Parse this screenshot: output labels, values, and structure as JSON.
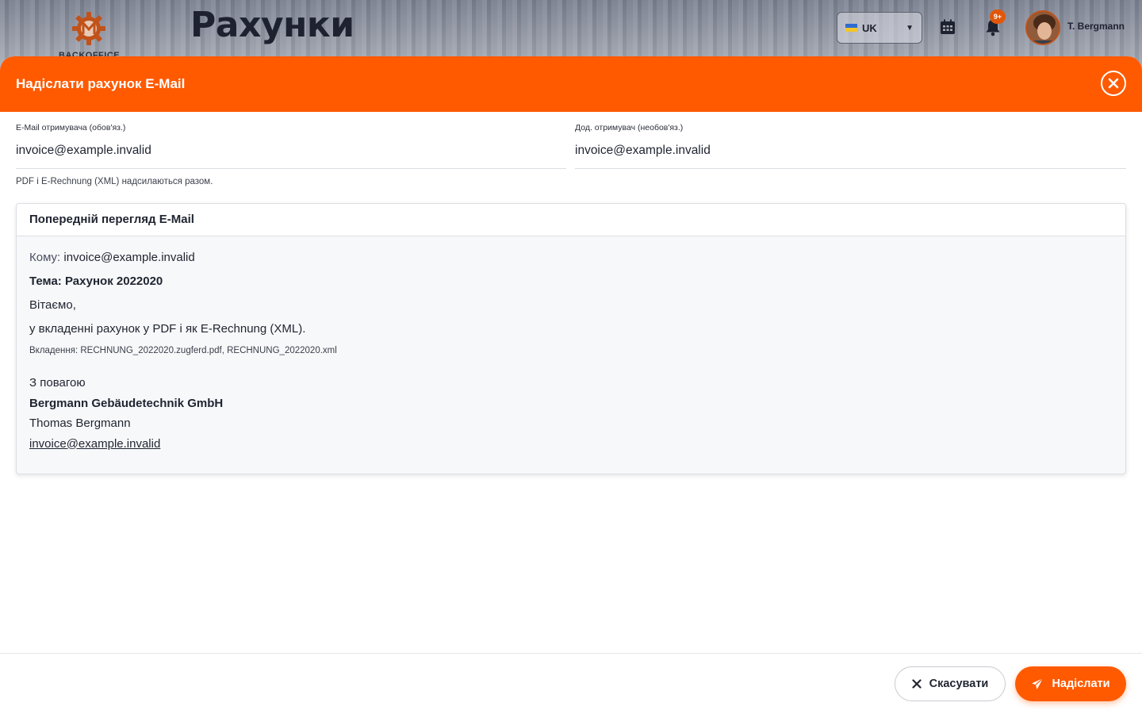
{
  "app": {
    "logo_text": "BACKOFFICE",
    "page_title": "Рахунки",
    "language": "UK",
    "notification_badge": "9+",
    "user_name": "T. Bergmann",
    "icons": [
      "logo-icon",
      "calendar-icon",
      "bell-icon",
      "avatar"
    ]
  },
  "colors": {
    "accent": "#ff5a00",
    "text": "#1f2430"
  },
  "modal": {
    "title": "Надіслати рахунок E-Mail",
    "recipient": {
      "label": "E-Mail отримувача (обов'яз.)",
      "value": "invoice@example.invalid"
    },
    "additional_recipient": {
      "label": "Дод. отримувач (необов'яз.)",
      "value": "invoice@example.invalid"
    },
    "hint": "PDF і E-Rechnung (XML) надсилаються разом.",
    "preview": {
      "heading": "Попередній перегляд E-Mail",
      "to_label": "Кому:",
      "to_value": "invoice@example.invalid",
      "subject": "Тема: Рахунок 2022020",
      "greeting": "Вітаємо,",
      "body": "у вкладенні рахунок у PDF і як E-Rechnung (XML).",
      "attachments": "Вкладення: RECHNUNG_2022020.zugferd.pdf, RECHNUNG_2022020.xml",
      "closing": "З повагою",
      "company": "Bergmann Gebäudetechnik GmbH",
      "person": "Thomas Bergmann",
      "email": "invoice@example.invalid"
    },
    "cancel_label": "Скасувати",
    "send_label": "Надіслати"
  }
}
